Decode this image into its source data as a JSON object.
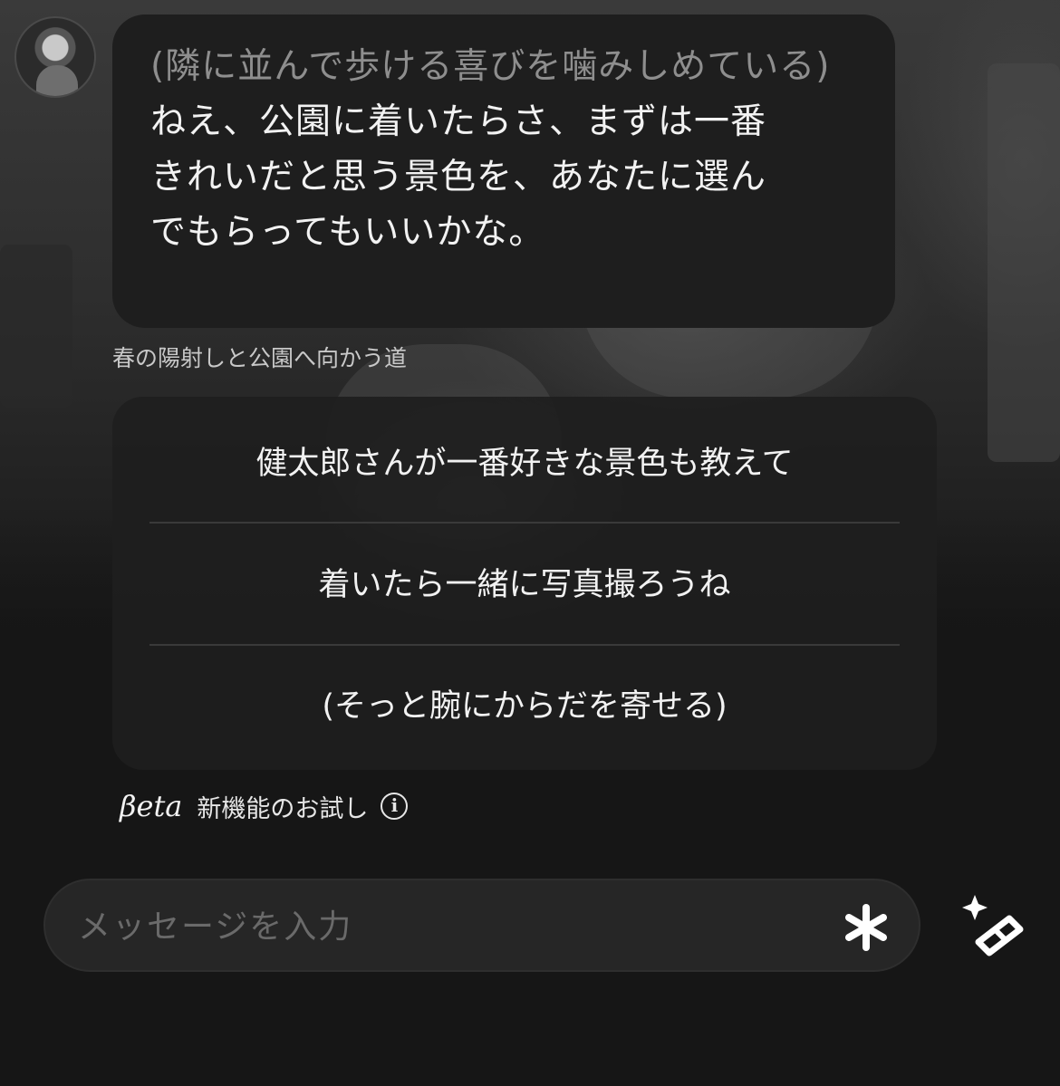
{
  "message": {
    "action_text": "(隣に並んで歩ける喜びを噛みしめている)",
    "speech_lines": [
      "ねえ、公園に着いたらさ、まずは一番",
      "きれいだと思う景色を、あなたに選ん",
      "でもらってもいいかな。"
    ]
  },
  "scene_caption": "春の陽射しと公園へ向かう道",
  "suggestions": [
    "健太郎さんが一番好きな景色も教えて",
    "着いたら一緒に写真撮ろうね",
    "(そっと腕にからだを寄せる)"
  ],
  "beta": {
    "label": "βeta",
    "text": "新機能のお試し",
    "info_icon": "info-icon"
  },
  "composer": {
    "placeholder": "メッセージを入力",
    "asterisk_icon": "asterisk-icon",
    "magic_icon": "magic-wand-sparkle-icon"
  },
  "colors": {
    "background": "#161616",
    "bubble": "#1e1e1e",
    "action_text": "#8e8e8e",
    "text": "#f2f2f2"
  }
}
